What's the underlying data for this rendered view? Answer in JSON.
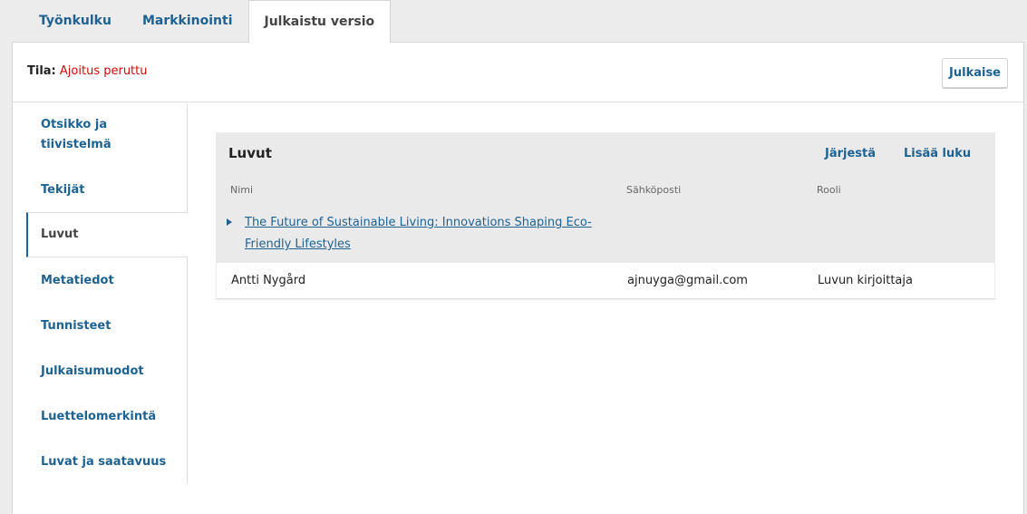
{
  "tabs": [
    {
      "label": "Työnkulku",
      "active": false
    },
    {
      "label": "Markkinointi",
      "active": false
    },
    {
      "label": "Julkaistu versio",
      "active": true
    }
  ],
  "status": {
    "label": "Tila:",
    "value": "Ajoitus peruttu"
  },
  "publish_button": "Julkaise",
  "sidenav": {
    "items": [
      {
        "label": "Otsikko ja tiivistelmä"
      },
      {
        "label": "Tekijät"
      },
      {
        "label": "Luvut",
        "active": true
      },
      {
        "label": "Metatiedot"
      },
      {
        "label": "Tunnisteet"
      },
      {
        "label": "Julkaisumuodot"
      },
      {
        "label": "Luettelomerkintä"
      },
      {
        "label": "Luvat ja saatavuus"
      }
    ]
  },
  "chapters": {
    "title": "Luvut",
    "actions": {
      "sort": "Järjestä",
      "add": "Lisää luku"
    },
    "columns": {
      "name": "Nimi",
      "email": "Sähköposti",
      "role": "Rooli"
    },
    "items": [
      {
        "title": "The Future of Sustainable Living: Innovations Shaping Eco-Friendly Lifestyles",
        "authors": [
          {
            "name": "Antti Nygård",
            "email": "ajnuyga@gmail.com",
            "role": "Luvun kirjoittaja"
          }
        ]
      }
    ]
  },
  "colors": {
    "link": "#1e6292",
    "status_error": "#d00a0a"
  }
}
